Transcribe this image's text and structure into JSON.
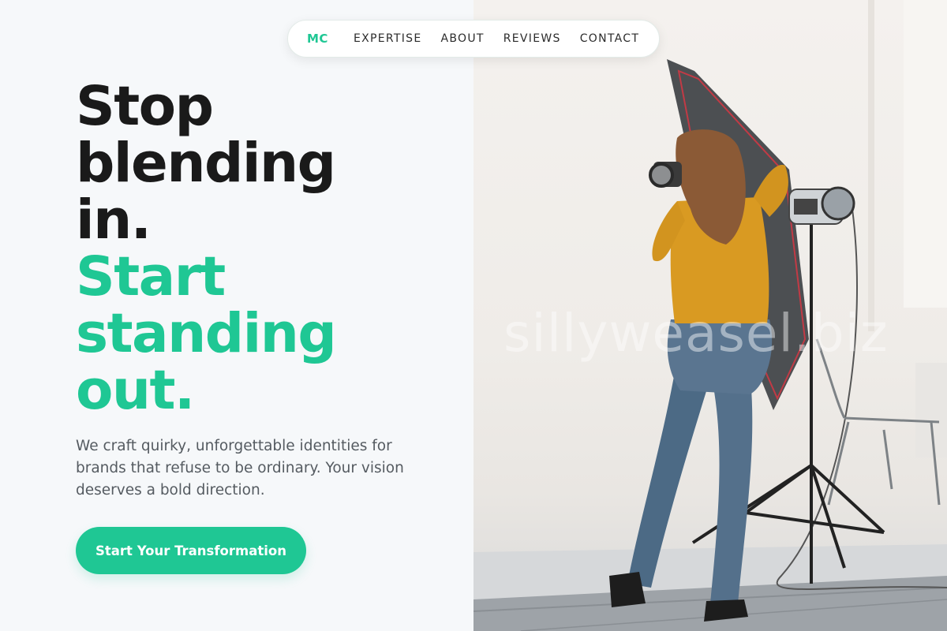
{
  "brand": {
    "logo": "MC",
    "accent_color": "#1fc794"
  },
  "nav": {
    "links": [
      {
        "label": "EXPERTISE"
      },
      {
        "label": "ABOUT"
      },
      {
        "label": "REVIEWS"
      },
      {
        "label": "CONTACT"
      }
    ]
  },
  "hero": {
    "headline_dark": [
      "Stop",
      "blending",
      "in."
    ],
    "headline_green": [
      "Start",
      "standing",
      "out."
    ],
    "description": "We craft quirky, unforgettable identities for brands that refuse to be ordinary. Your vision deserves a bold direction.",
    "cta_label": "Start Your Transformation"
  },
  "photo": {
    "watermark": "sillyweasel.biz"
  }
}
